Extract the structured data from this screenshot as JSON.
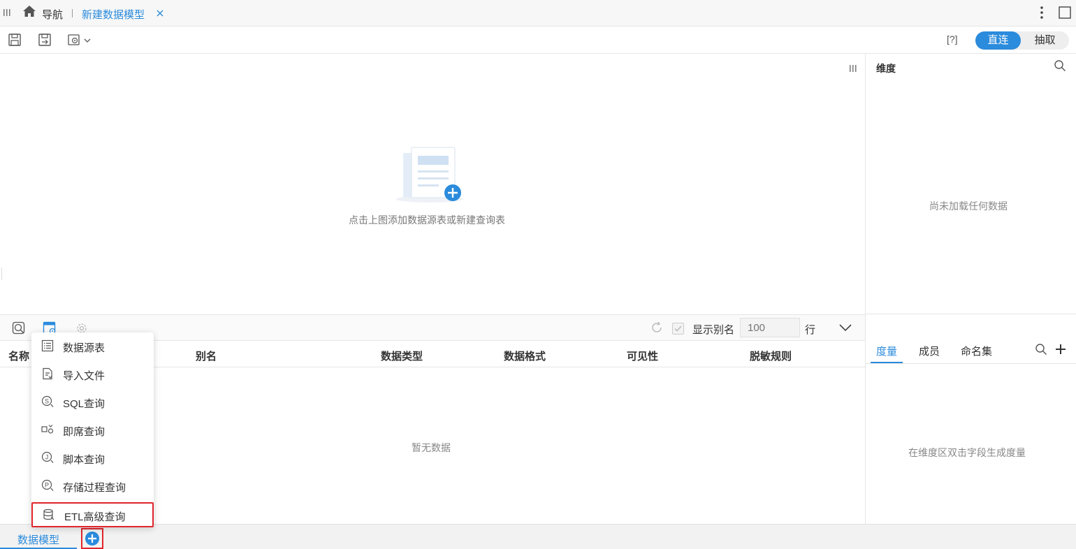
{
  "top_tabs": {
    "nav_label": "导航",
    "active_tab": "新建数据模型"
  },
  "toolbar": {
    "help_label": "[?]",
    "mode_direct": "直连",
    "mode_extract": "抽取"
  },
  "canvas": {
    "hint": "点击上图添加数据源表或新建查询表"
  },
  "mid_toolbar": {
    "show_alias_label": "显示别名",
    "rows_placeholder": "100",
    "rows_unit": "行"
  },
  "table": {
    "columns": [
      "名称",
      "别名",
      "数据类型",
      "数据格式",
      "可见性",
      "脱敏规则"
    ],
    "empty": "暂无数据"
  },
  "dropdown_menu": {
    "items": [
      {
        "label": "数据源表",
        "icon": "table-list-icon"
      },
      {
        "label": "导入文件",
        "icon": "file-import-icon"
      },
      {
        "label": "SQL查询",
        "icon": "sql-query-icon"
      },
      {
        "label": "即席查询",
        "icon": "adhoc-query-icon"
      },
      {
        "label": "脚本查询",
        "icon": "script-query-icon"
      },
      {
        "label": "存储过程查询",
        "icon": "procedure-query-icon"
      },
      {
        "label": "ETL高级查询",
        "icon": "etl-query-icon"
      }
    ]
  },
  "right_panel": {
    "dimension_title": "维度",
    "dimension_empty": "尚未加载任何数据",
    "tabs": [
      "度量",
      "成员",
      "命名集"
    ],
    "measure_empty": "在维度区双击字段生成度量"
  },
  "bottom": {
    "model_tab": "数据模型"
  },
  "colors": {
    "accent": "#2b8bdc",
    "highlight_border": "#e0252c"
  }
}
